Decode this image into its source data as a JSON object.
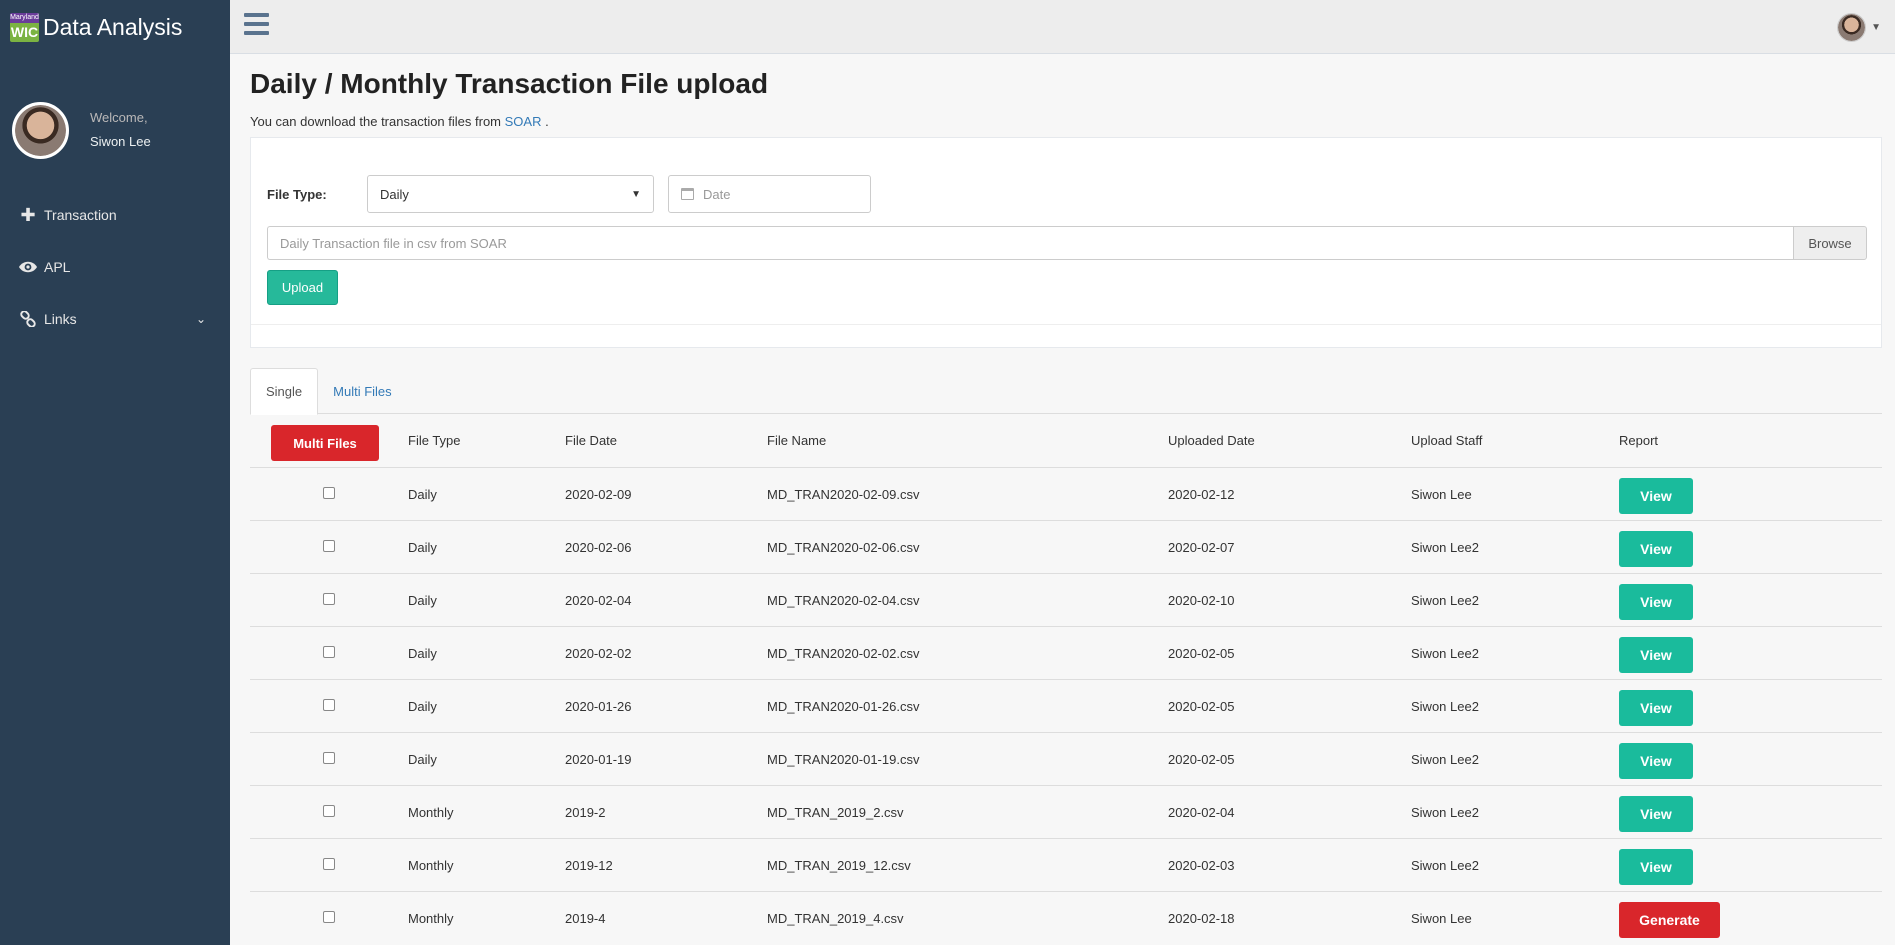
{
  "brand": {
    "logo_top": "Maryland",
    "logo_bottom": "WIC",
    "title": "Data Analysis"
  },
  "profile": {
    "welcome": "Welcome,",
    "name": "Siwon Lee"
  },
  "sidebar": {
    "items": [
      {
        "label": "Transaction",
        "icon": "plus-icon"
      },
      {
        "label": "APL",
        "icon": "eye-icon"
      },
      {
        "label": "Links",
        "icon": "link-icon"
      }
    ]
  },
  "page": {
    "title": "Daily / Monthly Transaction File upload",
    "subtitle_prefix": "You can download the transaction files from",
    "subtitle_link": "SOAR",
    "subtitle_suffix": "."
  },
  "form": {
    "file_type_label": "File Type:",
    "file_type_value": "Daily",
    "date_placeholder": "Date",
    "file_placeholder": "Daily Transaction file in csv from SOAR",
    "browse_label": "Browse",
    "upload_label": "Upload"
  },
  "tabs": [
    {
      "label": "Single",
      "active": true
    },
    {
      "label": "Multi Files",
      "active": false
    }
  ],
  "table": {
    "multi_button": "Multi Files",
    "headers": [
      "File Type",
      "File Date",
      "File Name",
      "Uploaded Date",
      "Upload Staff",
      "Report"
    ],
    "rows": [
      {
        "type": "Daily",
        "file_date": "2020-02-09",
        "file_name": "MD_TRAN2020-02-09.csv",
        "uploaded": "2020-02-12",
        "staff": "Siwon Lee",
        "report": "View"
      },
      {
        "type": "Daily",
        "file_date": "2020-02-06",
        "file_name": "MD_TRAN2020-02-06.csv",
        "uploaded": "2020-02-07",
        "staff": "Siwon Lee2",
        "report": "View"
      },
      {
        "type": "Daily",
        "file_date": "2020-02-04",
        "file_name": "MD_TRAN2020-02-04.csv",
        "uploaded": "2020-02-10",
        "staff": "Siwon Lee2",
        "report": "View"
      },
      {
        "type": "Daily",
        "file_date": "2020-02-02",
        "file_name": "MD_TRAN2020-02-02.csv",
        "uploaded": "2020-02-05",
        "staff": "Siwon Lee2",
        "report": "View"
      },
      {
        "type": "Daily",
        "file_date": "2020-01-26",
        "file_name": "MD_TRAN2020-01-26.csv",
        "uploaded": "2020-02-05",
        "staff": "Siwon Lee2",
        "report": "View"
      },
      {
        "type": "Daily",
        "file_date": "2020-01-19",
        "file_name": "MD_TRAN2020-01-19.csv",
        "uploaded": "2020-02-05",
        "staff": "Siwon Lee2",
        "report": "View"
      },
      {
        "type": "Monthly",
        "file_date": "2019-2",
        "file_name": "MD_TRAN_2019_2.csv",
        "uploaded": "2020-02-04",
        "staff": "Siwon Lee2",
        "report": "View"
      },
      {
        "type": "Monthly",
        "file_date": "2019-12",
        "file_name": "MD_TRAN_2019_12.csv",
        "uploaded": "2020-02-03",
        "staff": "Siwon Lee2",
        "report": "View"
      },
      {
        "type": "Monthly",
        "file_date": "2019-4",
        "file_name": "MD_TRAN_2019_4.csv",
        "uploaded": "2020-02-18",
        "staff": "Siwon Lee",
        "report": "Generate"
      }
    ]
  },
  "colors": {
    "sidebar": "#2a3f54",
    "view_button": "#1abb9c",
    "red_button": "#d9262b",
    "upload_button": "#26b99a",
    "link": "#337ab7"
  }
}
